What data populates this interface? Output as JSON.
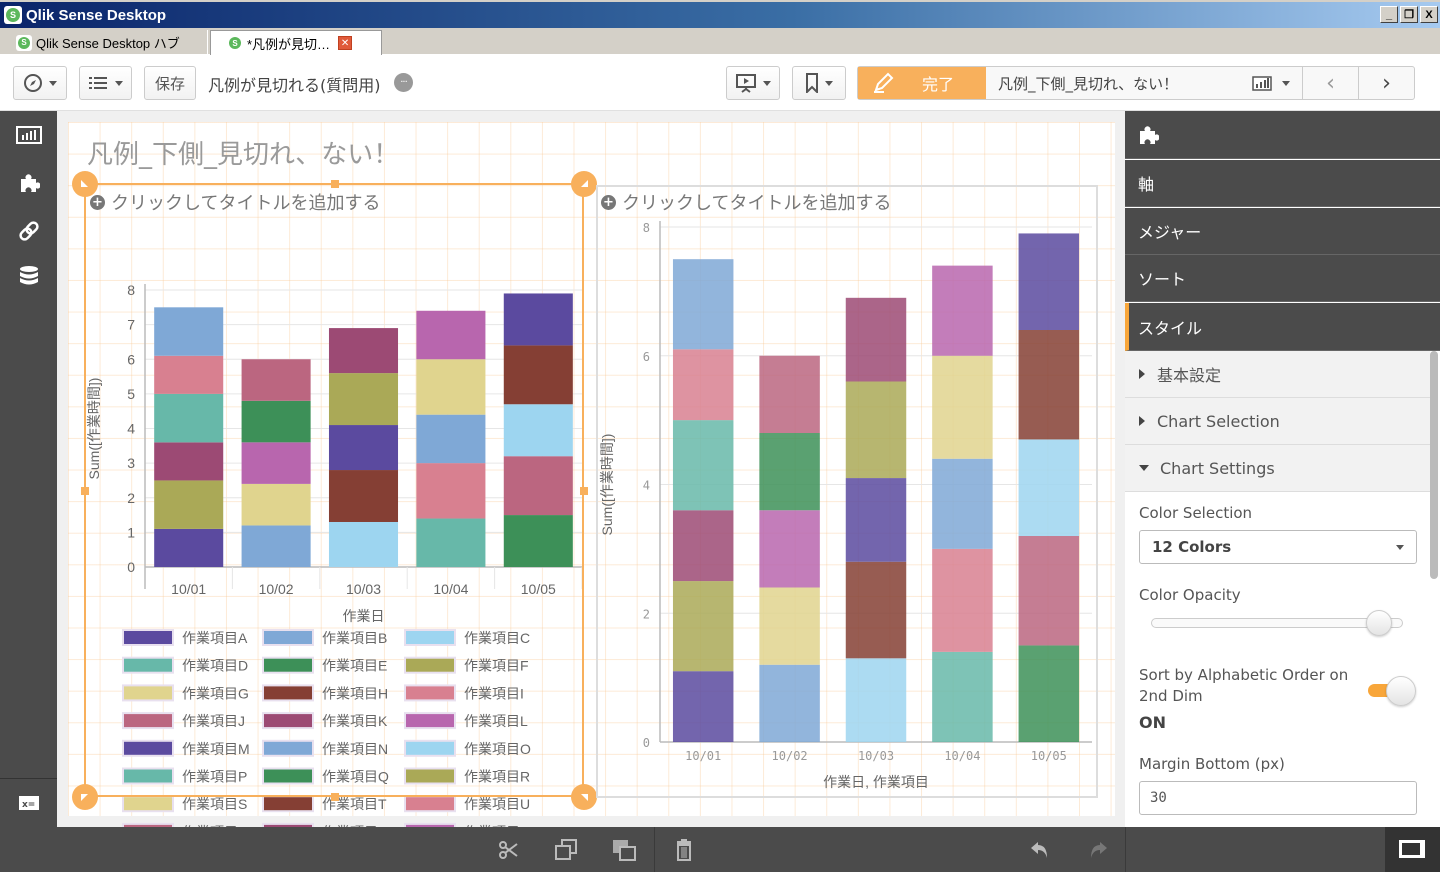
{
  "window": {
    "title": "Qlik Sense Desktop",
    "controls": [
      "_",
      "❐",
      "X"
    ],
    "tabs": [
      {
        "label": "Qlik Sense Desktop ハブ",
        "active": false
      },
      {
        "label": "*凡例が見切…",
        "active": true,
        "closable": true
      }
    ]
  },
  "toolbar": {
    "navigation_icon": "compass-icon",
    "list_icon": "list-icon",
    "save_label": "保存",
    "app_title": "凡例が見切れる(質問用)",
    "more_icon": "···",
    "present_icon": "presentation-icon",
    "bookmark_icon": "bookmark-icon",
    "done_label": "完了",
    "sheet_name": "凡例_下側_見切れ、ない！",
    "prev_label": "‹",
    "next_label": "›"
  },
  "left_sidebar": {
    "items": [
      {
        "icon": "chart-icon",
        "label": "Charts"
      },
      {
        "icon": "puzzle-icon",
        "label": "Extensions"
      },
      {
        "icon": "link-icon",
        "label": "Master items"
      },
      {
        "icon": "database-icon",
        "label": "Fields"
      }
    ],
    "bottom_icon": "variables-icon"
  },
  "sheet": {
    "title": "凡例_下側_見切れ、ない！",
    "objects": [
      {
        "placeholder_title": "クリックしてタイトルを追加する",
        "selected": true
      },
      {
        "placeholder_title": "クリックしてタイトルを追加する",
        "selected": false
      }
    ]
  },
  "chart_data": [
    {
      "type": "bar",
      "stacked": true,
      "title": "クリックしてタイトルを追加する",
      "xlabel": "作業日",
      "ylabel": "Sum([作業時間])",
      "ylim": [
        0,
        8
      ],
      "yticks": [
        0,
        1,
        2,
        3,
        4,
        5,
        6,
        7,
        8
      ],
      "categories": [
        "10/01",
        "10/02",
        "10/03",
        "10/04",
        "10/05"
      ],
      "stacks": [
        [
          {
            "item": "作業項目A",
            "value": 1.1
          },
          {
            "item": "作業項目F",
            "value": 1.4
          },
          {
            "item": "作業項目K",
            "value": 1.1
          },
          {
            "item": "作業項目D",
            "value": 1.4
          },
          {
            "item": "作業項目I",
            "value": 1.1
          },
          {
            "item": "作業項目B",
            "value": 1.4
          }
        ],
        [
          {
            "item": "作業項目N",
            "value": 1.2
          },
          {
            "item": "作業項目G",
            "value": 1.2
          },
          {
            "item": "作業項目L",
            "value": 1.2
          },
          {
            "item": "作業項目E",
            "value": 1.2
          },
          {
            "item": "作業項目J",
            "value": 1.2
          }
        ],
        [
          {
            "item": "作業項目O",
            "value": 1.3
          },
          {
            "item": "作業項目H",
            "value": 1.5
          },
          {
            "item": "作業項目M",
            "value": 1.3
          },
          {
            "item": "作業項目R",
            "value": 1.5
          },
          {
            "item": "作業項目W",
            "value": 1.3
          }
        ],
        [
          {
            "item": "作業項目P",
            "value": 1.4
          },
          {
            "item": "作業項目U",
            "value": 1.6
          },
          {
            "item": "作業項目B",
            "value": 1.4
          },
          {
            "item": "作業項目S",
            "value": 1.6
          },
          {
            "item": "作業項目X",
            "value": 1.4
          }
        ],
        [
          {
            "item": "作業項目Q",
            "value": 1.5
          },
          {
            "item": "作業項目V",
            "value": 1.7
          },
          {
            "item": "作業項目C",
            "value": 1.5
          },
          {
            "item": "作業項目T",
            "value": 1.7
          },
          {
            "item": "作業項目A",
            "value": 1.5
          }
        ]
      ],
      "legend": {
        "position": "bottom",
        "items": [
          "作業項目A",
          "作業項目B",
          "作業項目C",
          "作業項目D",
          "作業項目E",
          "作業項目F",
          "作業項目G",
          "作業項目H",
          "作業項目I",
          "作業項目J",
          "作業項目K",
          "作業項目L",
          "作業項目M",
          "作業項目N",
          "作業項目O",
          "作業項目P",
          "作業項目Q",
          "作業項目R",
          "作業項目S",
          "作業項目T",
          "作業項目U",
          "作業項目V",
          "作業項目W",
          "作業項目X"
        ]
      },
      "grid": true
    },
    {
      "type": "bar",
      "stacked": true,
      "title": "クリックしてタイトルを追加する",
      "xlabel": "作業日, 作業項目",
      "ylabel": "Sum([作業時間])",
      "ylim": [
        0,
        8
      ],
      "yticks": [
        0,
        2,
        4,
        6,
        8
      ],
      "categories": [
        "10/01",
        "10/02",
        "10/03",
        "10/04",
        "10/05"
      ],
      "same_data_as": "chart 1",
      "grid": true,
      "legend": {
        "position": "none"
      }
    }
  ],
  "palette": [
    "#5b4a9f",
    "#7fa8d6",
    "#9dd5f0",
    "#67b8a9",
    "#3d9058",
    "#aaa957",
    "#e0d48e",
    "#853f34",
    "#d88090",
    "#bb6680",
    "#9c4a74",
    "#b866ae"
  ],
  "right_panel": {
    "top_icon": "puzzle-icon",
    "sections": [
      {
        "label": "軸",
        "active": false
      },
      {
        "label": "メジャー",
        "active": false
      },
      {
        "label": "ソート",
        "active": false
      },
      {
        "label": "スタイル",
        "active": true
      }
    ],
    "accordions": [
      {
        "label": "基本設定",
        "expanded": false
      },
      {
        "label": "Chart Selection",
        "expanded": false
      },
      {
        "label": "Chart Settings",
        "expanded": true
      }
    ],
    "settings": {
      "color_selection_label": "Color Selection",
      "color_selection_value": "12 Colors",
      "color_opacity_label": "Color Opacity",
      "color_opacity_value": 0.9,
      "sort_label": "Sort by Alphabetic Order on 2nd Dim",
      "sort_state": "ON",
      "margin_bottom_label": "Margin Bottom (px)",
      "margin_bottom_value": "30"
    }
  },
  "bottom_bar": {
    "icons": [
      "scissors-icon",
      "copy-icon",
      "paste-icon",
      "delete-icon",
      "undo-icon",
      "redo-icon",
      "panel-toggle-icon"
    ]
  }
}
